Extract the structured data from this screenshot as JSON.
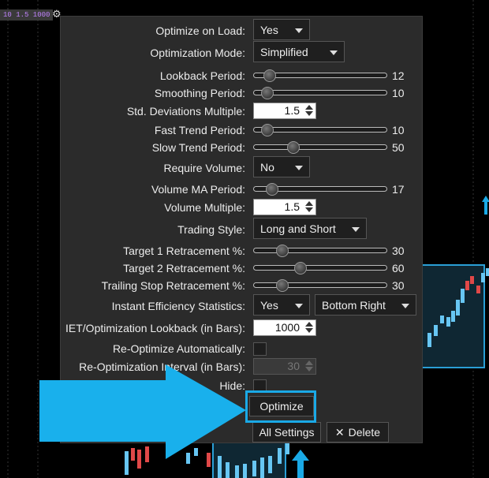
{
  "chart_tag": "10 1.5 1000",
  "fields": [
    {
      "label": "Optimize on Load:",
      "type": "select",
      "value": "Yes",
      "width": 72
    },
    {
      "label": "Optimization Mode:",
      "type": "select",
      "value": "Simplified",
      "width": 116
    },
    {
      "label": "Lookback Period:",
      "type": "slider",
      "value": "12",
      "pos": 0.08
    },
    {
      "label": "Smoothing Period:",
      "type": "slider",
      "value": "10",
      "pos": 0.06
    },
    {
      "label": "Std. Deviations Multiple:",
      "type": "spin",
      "value": "1.5"
    },
    {
      "label": "Fast Trend Period:",
      "type": "slider",
      "value": "10",
      "pos": 0.06
    },
    {
      "label": "Slow Trend Period:",
      "type": "slider",
      "value": "50",
      "pos": 0.27
    },
    {
      "label": "Require Volume:",
      "type": "select",
      "value": "No",
      "width": 72
    },
    {
      "label": "Volume MA Period:",
      "type": "slider",
      "value": "17",
      "pos": 0.1
    },
    {
      "label": "Volume Multiple:",
      "type": "spin",
      "value": "1.5"
    },
    {
      "label": "Trading Style:",
      "type": "select",
      "value": "Long and Short",
      "width": 144
    },
    {
      "label": "Target 1 Retracement %:",
      "type": "slider",
      "value": "30",
      "pos": 0.18
    },
    {
      "label": "Target 2 Retracement %:",
      "type": "slider",
      "value": "60",
      "pos": 0.33
    },
    {
      "label": "Trailing Stop Retracement %:",
      "type": "slider",
      "value": "30",
      "pos": 0.18
    },
    {
      "label": "Instant Efficiency Statistics:",
      "type": "select2",
      "value": "Yes",
      "value2": "Bottom Right"
    },
    {
      "label": "IET/Optimization Lookback (in Bars):",
      "type": "spin",
      "value": "1000"
    },
    {
      "label": "Re-Optimize Automatically:",
      "type": "check"
    },
    {
      "label": "Re-Optimization Interval (in Bars):",
      "type": "spin-disabled",
      "value": "30"
    },
    {
      "label": "Hide:",
      "type": "check"
    }
  ],
  "buttons": {
    "optimize": "Optimize",
    "all_settings": "All Settings",
    "delete": "Delete",
    "delete_icon": "✕"
  },
  "colors": {
    "accent": "#1aa9e6",
    "panel": "#2b2b2b",
    "candle_up": "#67c6f3",
    "candle_down": "#e04848"
  },
  "icons": [
    "gear-icon",
    "close-icon",
    "big-arrow-icon",
    "up-arrow-icon",
    "chevron-down-icon"
  ]
}
